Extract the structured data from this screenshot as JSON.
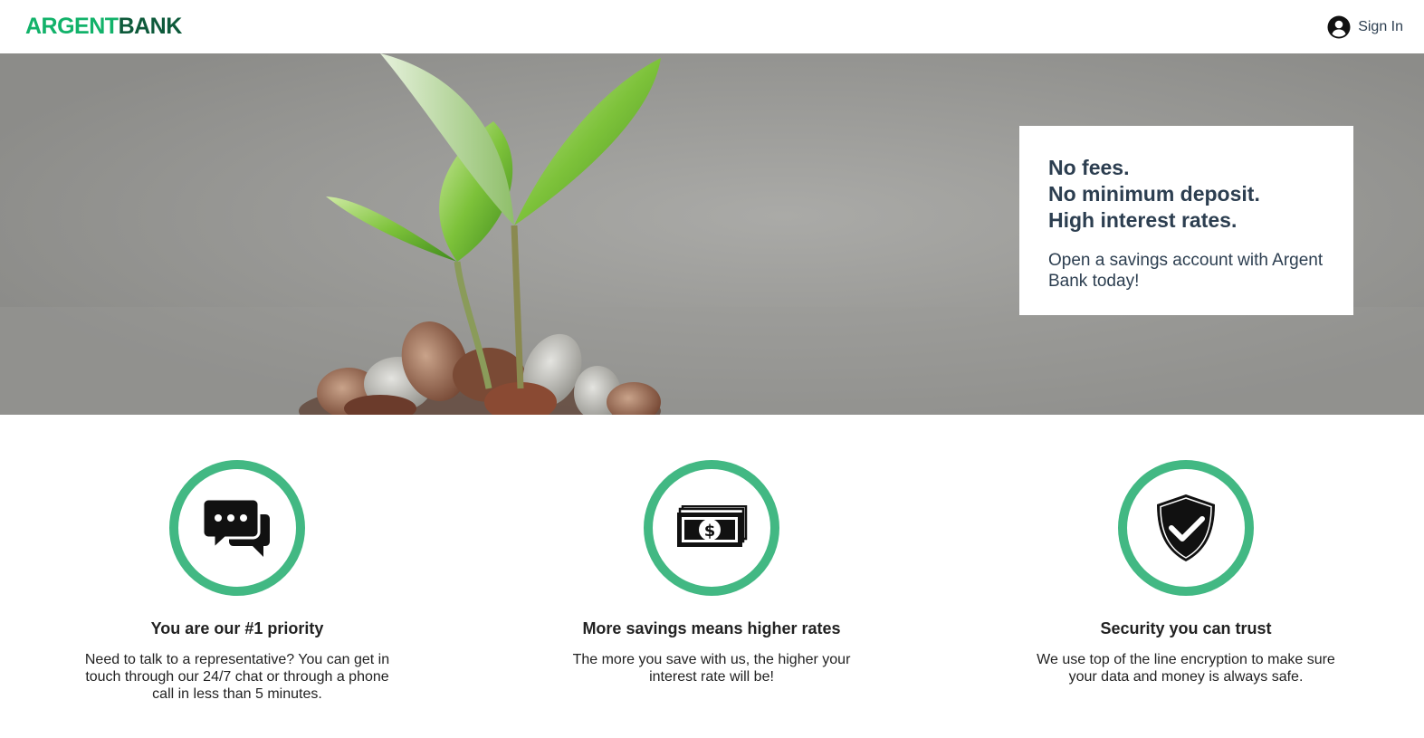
{
  "nav": {
    "logo_part1": "ARGENT",
    "logo_part2": "BANK",
    "sign_in_label": "Sign In",
    "icon": "user-circle-icon"
  },
  "hero": {
    "subtitles": [
      "No fees.",
      "No minimum deposit.",
      "High interest rates."
    ],
    "text": "Open a savings account with Argent Bank today!",
    "image": "plant-growing-from-coins-photo"
  },
  "features": [
    {
      "icon": "chat-icon",
      "title": "You are our #1 priority",
      "text": "Need to talk to a representative? You can get in touch through our 24/7 chat or through a phone call in less than 5 minutes."
    },
    {
      "icon": "money-icon",
      "title": "More savings means higher rates",
      "text": "The more you save with us, the higher your interest rate will be!"
    },
    {
      "icon": "security-shield-icon",
      "title": "Security you can trust",
      "text": "We use top of the line encryption to make sure your data and money is always safe."
    }
  ],
  "colors": {
    "brand_green": "#12b26a",
    "brand_dark_green": "#0e5a3b",
    "icon_ring": "#42b883",
    "text": "#2c3e50"
  }
}
